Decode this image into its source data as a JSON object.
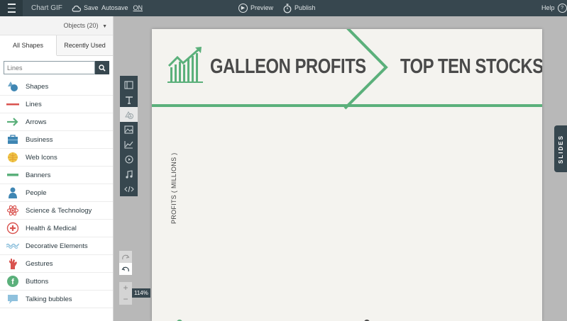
{
  "topbar": {
    "app_title": "Chart GIF",
    "save_label": "Save",
    "autosave_label": "Autosave",
    "autosave_state": "ON",
    "preview_label": "Preview",
    "publish_label": "Publish",
    "help_label": "Help"
  },
  "panel": {
    "objects_label": "Objects (20)",
    "tabs": [
      "All Shapes",
      "Recently Used"
    ],
    "search_placeholder": "Lines",
    "categories": [
      {
        "label": "Shapes",
        "icon": "shapes-icon"
      },
      {
        "label": "Lines",
        "icon": "line-icon"
      },
      {
        "label": "Arrows",
        "icon": "arrow-icon"
      },
      {
        "label": "Business",
        "icon": "briefcase-icon"
      },
      {
        "label": "Web Icons",
        "icon": "globe-icon"
      },
      {
        "label": "Banners",
        "icon": "banner-icon"
      },
      {
        "label": "People",
        "icon": "person-icon"
      },
      {
        "label": "Science & Technology",
        "icon": "atom-icon"
      },
      {
        "label": "Health & Medical",
        "icon": "medical-cross-icon"
      },
      {
        "label": "Decorative Elements",
        "icon": "wave-icon"
      },
      {
        "label": "Gestures",
        "icon": "hand-icon"
      },
      {
        "label": "Buttons",
        "icon": "button-icon"
      },
      {
        "label": "Talking bubbles",
        "icon": "speech-bubble-icon"
      }
    ]
  },
  "workspace": {
    "zoom_label": "114%",
    "slides_label": "SLIDES"
  },
  "canvas": {
    "title_left": "GALLEON PROFITS",
    "title_right": "TOP TEN STOCKS",
    "y_axis_label": "PROFITS ( MILLIONS )"
  },
  "colors": {
    "topbar": "#37474f",
    "accent_green": "#5bb07b",
    "title_text": "#4a4a4a"
  }
}
